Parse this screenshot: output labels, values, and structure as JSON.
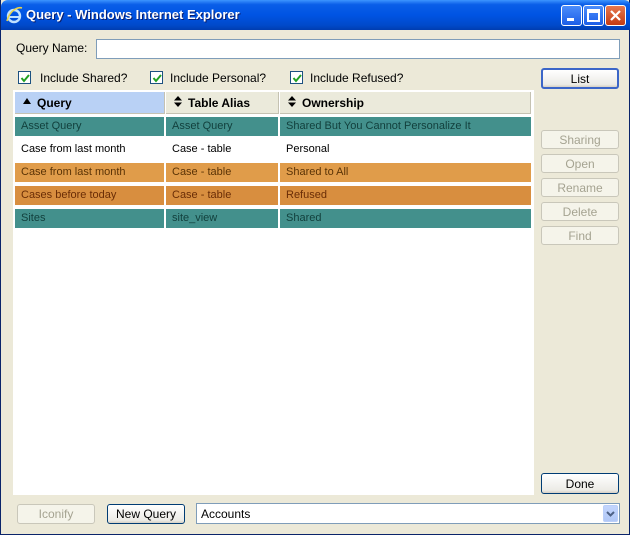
{
  "window": {
    "title": "Query - Windows Internet Explorer"
  },
  "form": {
    "query_name_label": "Query Name:",
    "query_name_value": "",
    "checks": [
      {
        "label": "Include Shared?",
        "checked": true
      },
      {
        "label": "Include Personal?",
        "checked": true
      },
      {
        "label": "Include Refused?",
        "checked": true
      }
    ]
  },
  "table": {
    "columns": [
      "Query",
      "Table Alias",
      "Ownership"
    ],
    "rows": [
      {
        "query": "Asset Query",
        "alias": "Asset Query",
        "ownership": "Shared But You Cannot Personalize It",
        "color": "#43908c"
      },
      {
        "query": "Case from last month",
        "alias": "Case - table",
        "ownership": "Personal",
        "color": "#ffffff"
      },
      {
        "query": "Case from last month",
        "alias": "Case - table",
        "ownership": "Shared to All",
        "color": "#e09c4a"
      },
      {
        "query": "Cases before today",
        "alias": "Case - table",
        "ownership": "Refused",
        "color": "#d88e3f"
      },
      {
        "query": "Sites",
        "alias": "site_view",
        "ownership": "Shared",
        "color": "#43908c"
      }
    ]
  },
  "buttons": {
    "list": "List",
    "sharing": "Sharing",
    "open": "Open",
    "rename": "Rename",
    "delete": "Delete",
    "find": "Find",
    "done": "Done",
    "iconify": "Iconify",
    "new_query": "New Query"
  },
  "select": {
    "value": "Accounts"
  }
}
